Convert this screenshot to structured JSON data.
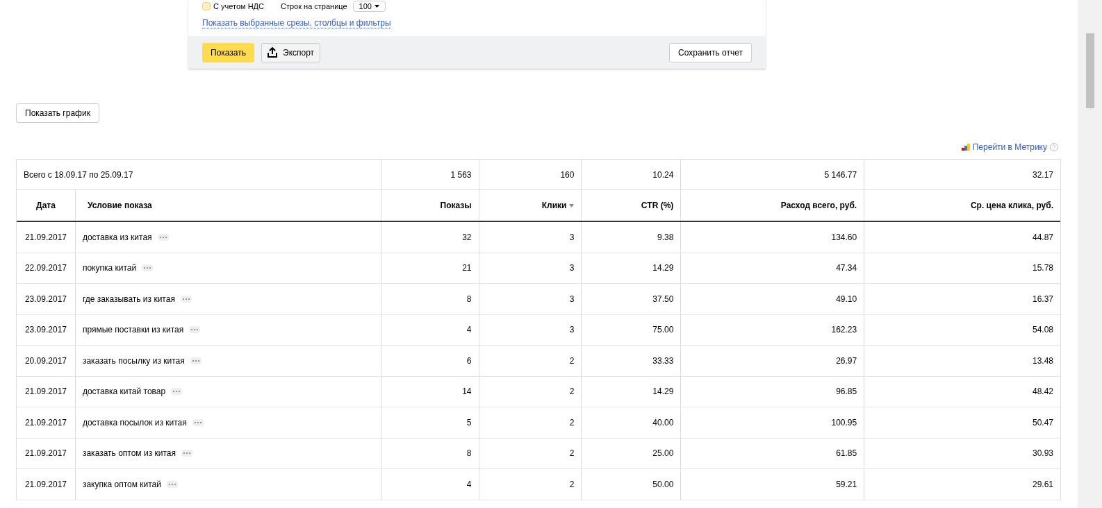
{
  "options": {
    "vat": {
      "label": "С учетом НДС",
      "checked": false
    },
    "rows_per_page": {
      "label": "Строк на странице",
      "value": "100"
    }
  },
  "show_selected_link": "Показать выбранные срезы, столбцы и фильтры",
  "footer_buttons": {
    "show": "Показать",
    "export": "Экспорт",
    "save": "Сохранить отчет"
  },
  "chart_button": "Показать график",
  "metrika_link": "Перейти в Метрику",
  "table": {
    "summary": {
      "label": "Всего с 18.09.17 по 25.09.17",
      "values": [
        "1 563",
        "160",
        "10.24",
        "5 146.77",
        "32.17"
      ]
    },
    "columns": [
      {
        "label": "Дата",
        "sorted": false
      },
      {
        "label": "Условие показа",
        "sorted": false
      },
      {
        "label": "Показы",
        "sorted": false
      },
      {
        "label": "Клики",
        "sorted": true
      },
      {
        "label": "CTR (%)",
        "sorted": false
      },
      {
        "label": "Расход всего, руб.",
        "sorted": false
      },
      {
        "label": "Ср. цена клика, руб.",
        "sorted": false
      }
    ],
    "rows": [
      {
        "date": "21.09.2017",
        "condition": "доставка из китая",
        "values": [
          "32",
          "3",
          "9.38",
          "134.60",
          "44.87"
        ]
      },
      {
        "date": "22.09.2017",
        "condition": "покупка китай",
        "values": [
          "21",
          "3",
          "14.29",
          "47.34",
          "15.78"
        ]
      },
      {
        "date": "23.09.2017",
        "condition": "где заказывать из китая",
        "values": [
          "8",
          "3",
          "37.50",
          "49.10",
          "16.37"
        ]
      },
      {
        "date": "23.09.2017",
        "condition": "прямые поставки из китая",
        "values": [
          "4",
          "3",
          "75.00",
          "162.23",
          "54.08"
        ]
      },
      {
        "date": "20.09.2017",
        "condition": "заказать посылку из китая",
        "values": [
          "6",
          "2",
          "33.33",
          "26.97",
          "13.48"
        ]
      },
      {
        "date": "21.09.2017",
        "condition": "доставка китай товар",
        "values": [
          "14",
          "2",
          "14.29",
          "96.85",
          "48.42"
        ]
      },
      {
        "date": "21.09.2017",
        "condition": "доставка посылок из китая",
        "values": [
          "5",
          "2",
          "40.00",
          "100.95",
          "50.47"
        ]
      },
      {
        "date": "21.09.2017",
        "condition": "заказать оптом из китая",
        "values": [
          "8",
          "2",
          "25.00",
          "61.85",
          "30.93"
        ]
      },
      {
        "date": "21.09.2017",
        "condition": "закупка оптом китай",
        "values": [
          "4",
          "2",
          "50.00",
          "59.21",
          "29.61"
        ]
      }
    ]
  }
}
